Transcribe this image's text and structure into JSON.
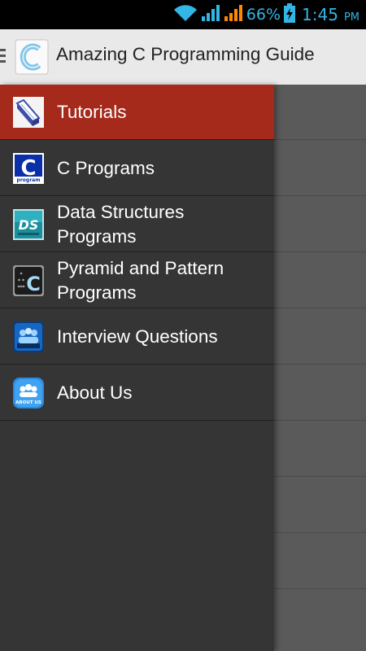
{
  "status_bar": {
    "battery": "66%",
    "time": "1:45",
    "ampm": "PM",
    "icons": [
      "wifi-icon",
      "signal-icon",
      "signal-icon-2",
      "battery-charging-icon"
    ],
    "colors": {
      "accent": "#33b5e5",
      "signal2": "#ff8800"
    }
  },
  "action_bar": {
    "title": "Amazing C Programming Guide",
    "logo_icon": "c-logo-icon"
  },
  "drawer": {
    "items": [
      {
        "label": "Tutorials",
        "icon": "tutorial-book-icon",
        "active": true
      },
      {
        "label": "C Programs",
        "icon": "c-program-icon",
        "active": false
      },
      {
        "label": "Data Structures Programs",
        "icon": "ds-icon",
        "active": false
      },
      {
        "label": "Pyramid and Pattern Programs",
        "icon": "pyramid-pattern-icon",
        "active": false
      },
      {
        "label": "Interview Questions",
        "icon": "interview-icon",
        "active": false
      },
      {
        "label": "About Us",
        "icon": "about-us-icon",
        "active": false
      }
    ],
    "colors": {
      "background": "#353535",
      "active": "#a52a1c"
    }
  }
}
